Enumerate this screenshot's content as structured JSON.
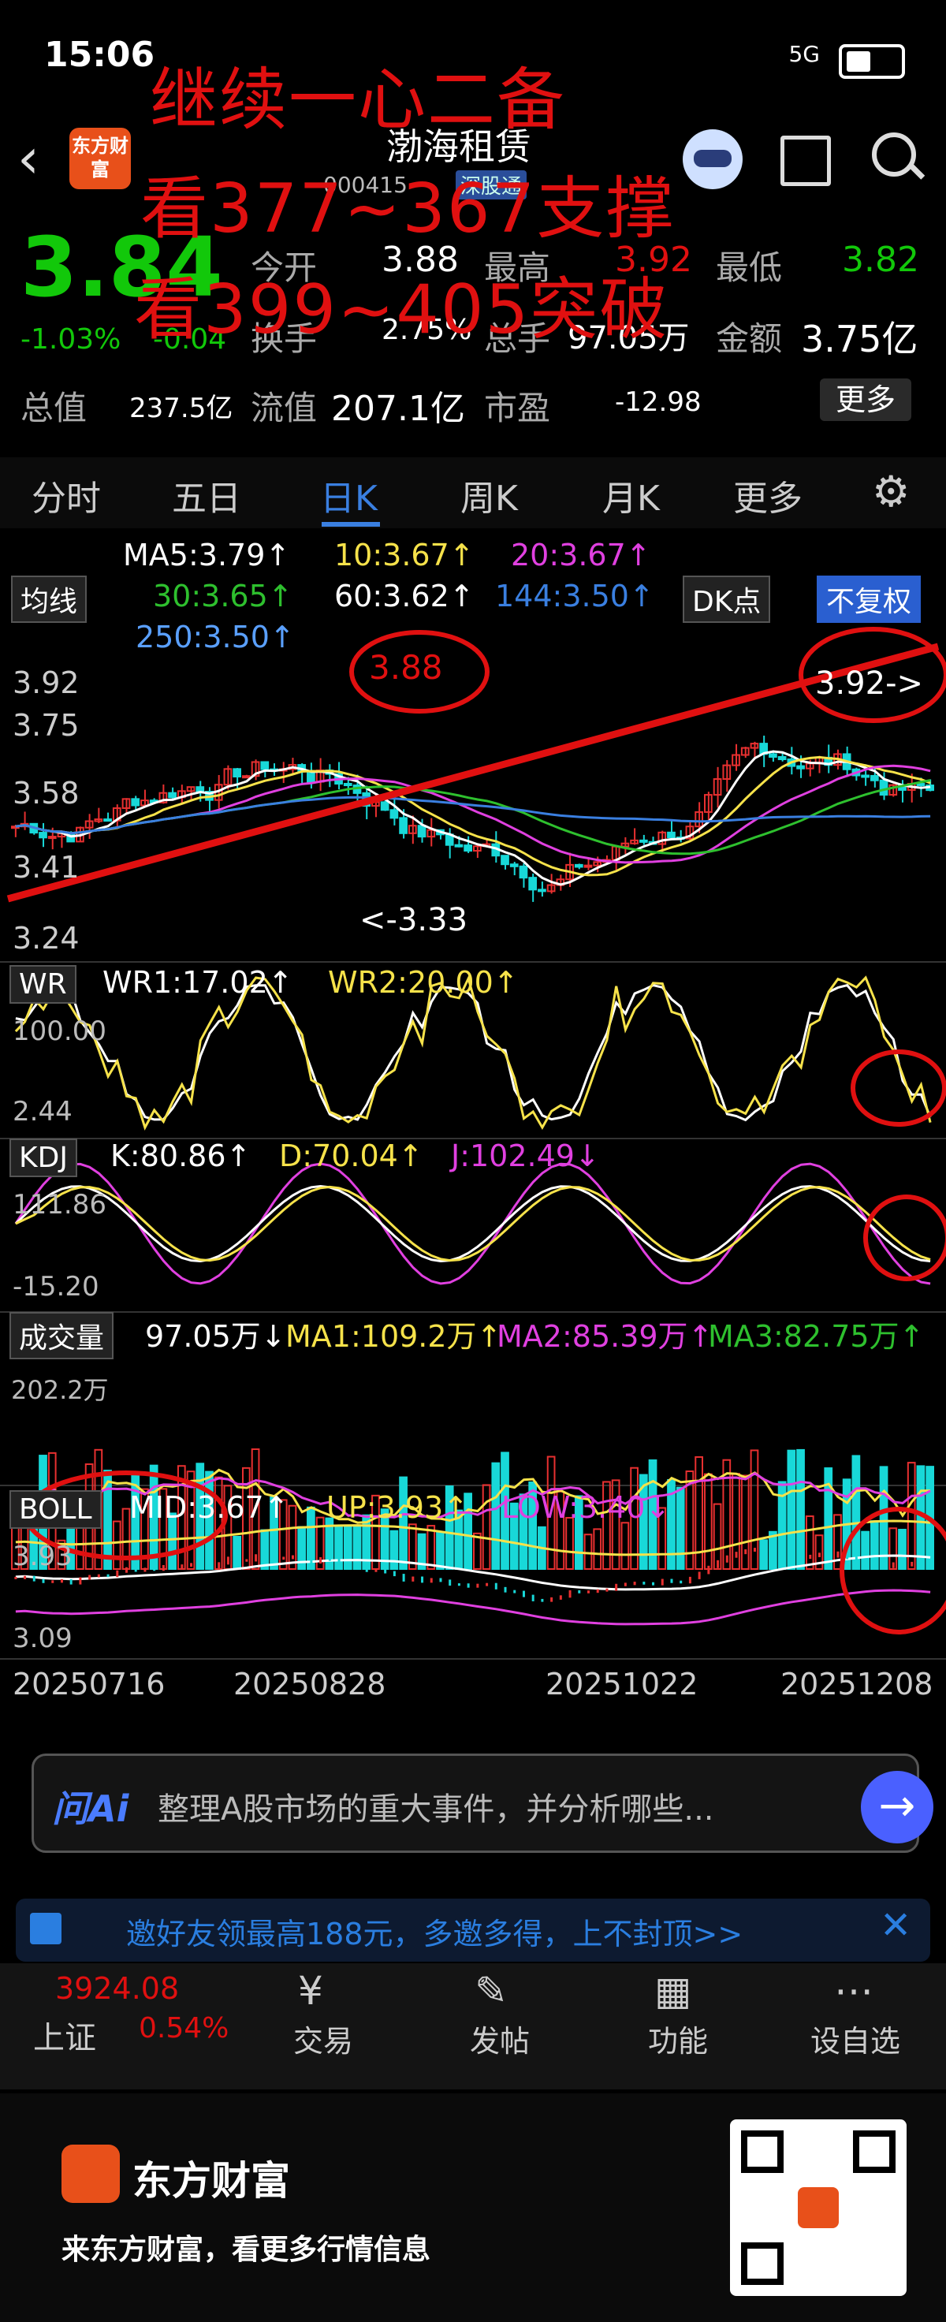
{
  "status_bar": {
    "time": "15:06",
    "network": "5G"
  },
  "annotations": [
    "继续一心二备",
    "看377~367支撑",
    "看399~405突破"
  ],
  "header": {
    "name": "渤海租赁",
    "code": "000415",
    "tag": "深股通",
    "logo_text": "东方财富"
  },
  "quote": {
    "price": "3.84",
    "change_pct": "-1.03%",
    "change": "-0.04",
    "open_label": "今开",
    "open": "3.88",
    "high_label": "最高",
    "high": "3.92",
    "low_label": "最低",
    "low": "3.82",
    "turnover_label": "换手",
    "turnover": "2.75%",
    "volume_label": "总手",
    "volume": "97.05万",
    "amount_label": "金额",
    "amount": "3.75亿",
    "mktcap_label": "总值",
    "mktcap": "237.5亿",
    "float_label": "流值",
    "float": "207.1亿",
    "pe_label": "市盈",
    "pe": "-12.98",
    "more_label": "更多"
  },
  "tabs": [
    "分时",
    "五日",
    "日K",
    "周K",
    "月K",
    "更多"
  ],
  "chart": {
    "ma_toggle": "均线",
    "ma5": "MA5:3.79↑",
    "ma10": "10:3.67↑",
    "ma20": "20:3.67↑",
    "ma30": "30:3.65↑",
    "ma60": "60:3.62↑",
    "ma144": "144:3.50↑",
    "ma250": "250:3.50↑",
    "dk": "DK点",
    "fq": "不复权",
    "y_top": "3.92",
    "y2": "3.75",
    "y3": "3.58",
    "y4": "3.41",
    "y5": "3.24",
    "peak_label": "3.88",
    "high_marker": "3.92->",
    "low_marker": "<-3.33",
    "wr_label": "WR",
    "wr1": "WR1:17.02↑",
    "wr2": "WR2:20.00↑",
    "wr_top": "100.00",
    "wr_bot": "2.44",
    "kdj_label": "KDJ",
    "k": "K:80.86↑",
    "d": "D:70.04↑",
    "j": "J:102.49↓",
    "kdj_top": "111.86",
    "kdj_bot": "-15.20",
    "vol_label": "成交量",
    "vol": "97.05万↓",
    "vma1": "MA1:109.2万↑",
    "vma2": "MA2:85.39万↑",
    "vma3": "MA3:82.75万↑",
    "vol_top": "202.2万",
    "boll_label": "BOLL",
    "mid": "MID:3.67↑",
    "up": "UP:3.93↑",
    "low": "LOW:3.40↓",
    "boll_top": "3.93",
    "boll_bot": "3.09",
    "dates": [
      "20250716",
      "20250828",
      "20251022",
      "20251208"
    ]
  },
  "ai": {
    "label": "问Ai",
    "text": "整理A股市场的重大事件，并分析哪些..."
  },
  "banner": {
    "text": "邀好友领最高188元，多邀多得，上不封顶>>"
  },
  "bottom": {
    "index_value": "3924.08",
    "index_name": "上证",
    "index_pct": "0.54%",
    "trade": "交易",
    "post": "发帖",
    "func": "功能",
    "watch": "设自选"
  },
  "footer": {
    "brand": "东方财富",
    "slogan": "来东方财富，看更多行情信息"
  }
}
